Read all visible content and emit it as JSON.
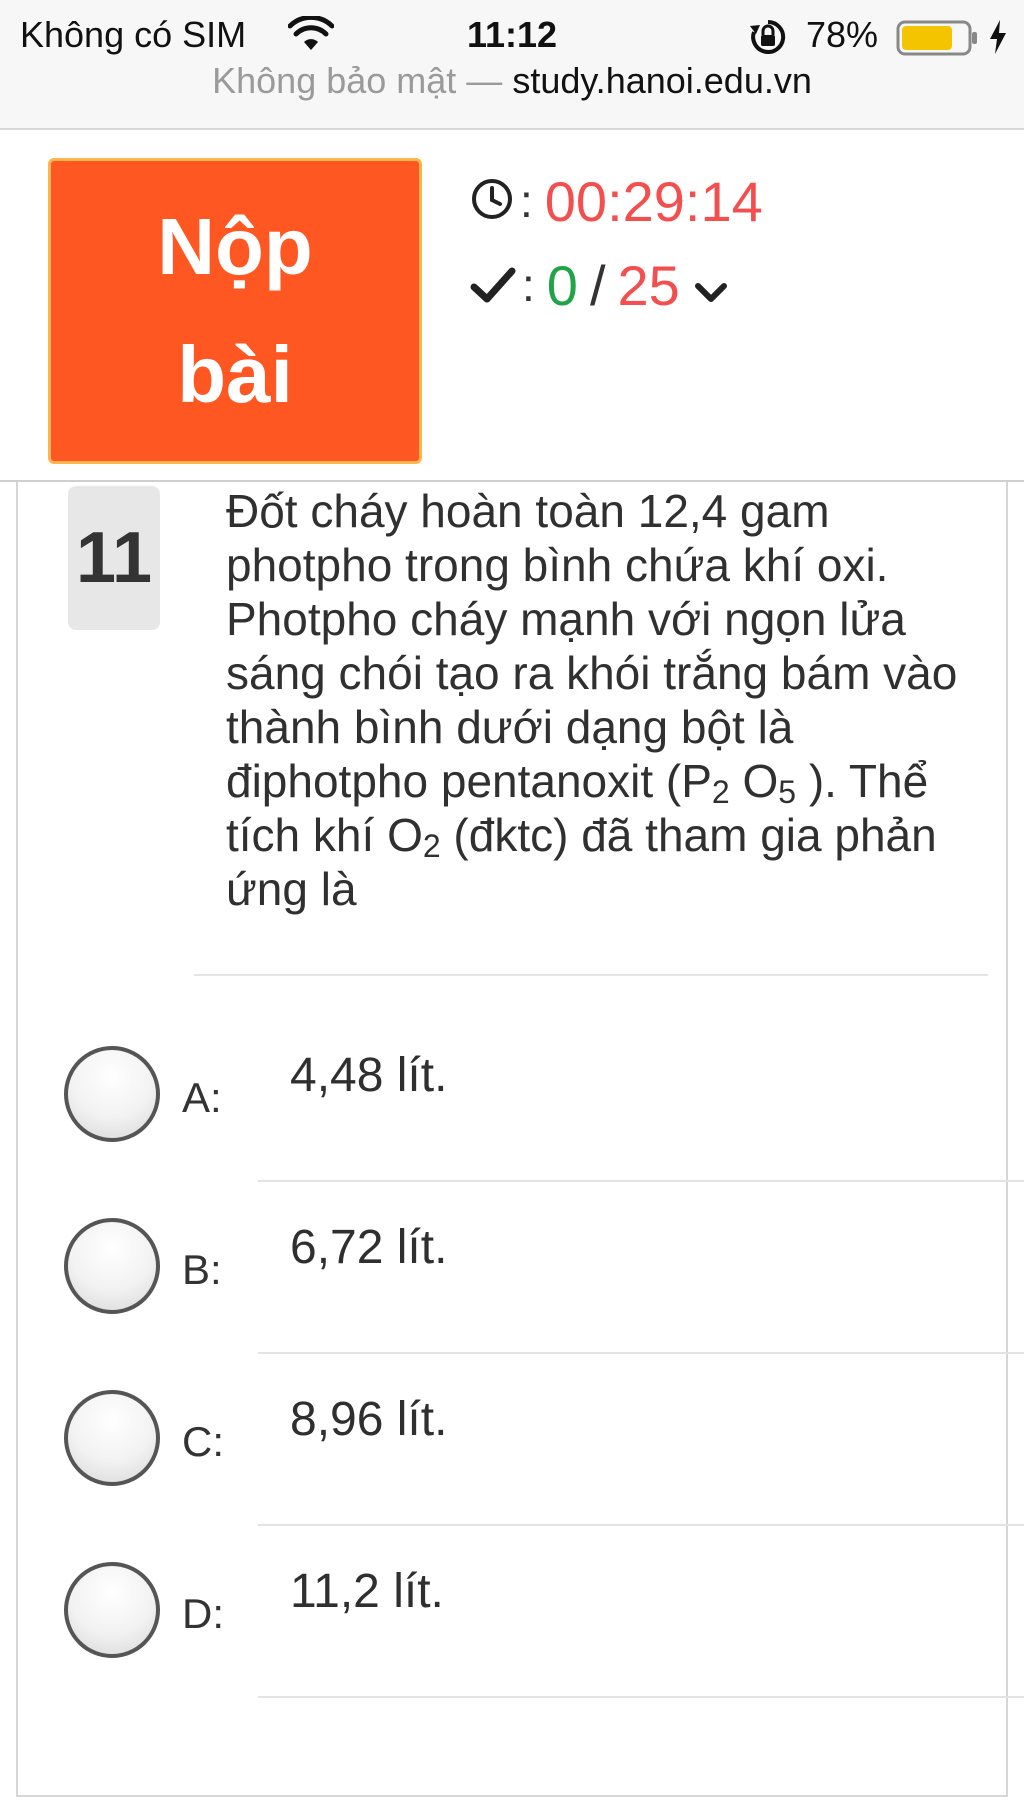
{
  "status_bar": {
    "carrier": "Không có SIM",
    "time": "11:12",
    "battery": "78%",
    "url_prefix": "Không bảo mật — ",
    "url_domain": "study.hanoi.edu.vn"
  },
  "header": {
    "submit_label": "Nộp bài",
    "separator": ":",
    "timer": "00:29:14",
    "answered": "0",
    "slash": "/",
    "total": "25"
  },
  "question": {
    "number": "11",
    "text_1": "Đốt cháy hoàn toàn 12,4 gam photpho trong bình chứa khí oxi. Photpho cháy mạnh với ngọn lửa sáng chói tạo ra khói trắng bám vào thành bình dưới dạng bột là điphotpho pentanoxit (P",
    "sub_1": "2",
    "text_2": " O",
    "sub_2": "5",
    "text_3": " ). Thể tích khí O",
    "sub_3": "2",
    "text_4": " (đktc) đã tham gia phản ứng là"
  },
  "options": [
    {
      "letter": "A:",
      "text": "4,48 lít."
    },
    {
      "letter": "B:",
      "text": "6,72 lít."
    },
    {
      "letter": "C:",
      "text": "8,96 lít."
    },
    {
      "letter": "D:",
      "text": "11,2 lít."
    }
  ],
  "colors": {
    "submit_bg": "#ff5722",
    "timer": "#f44f4f",
    "answered": "#21a348",
    "total": "#f44f4f"
  }
}
